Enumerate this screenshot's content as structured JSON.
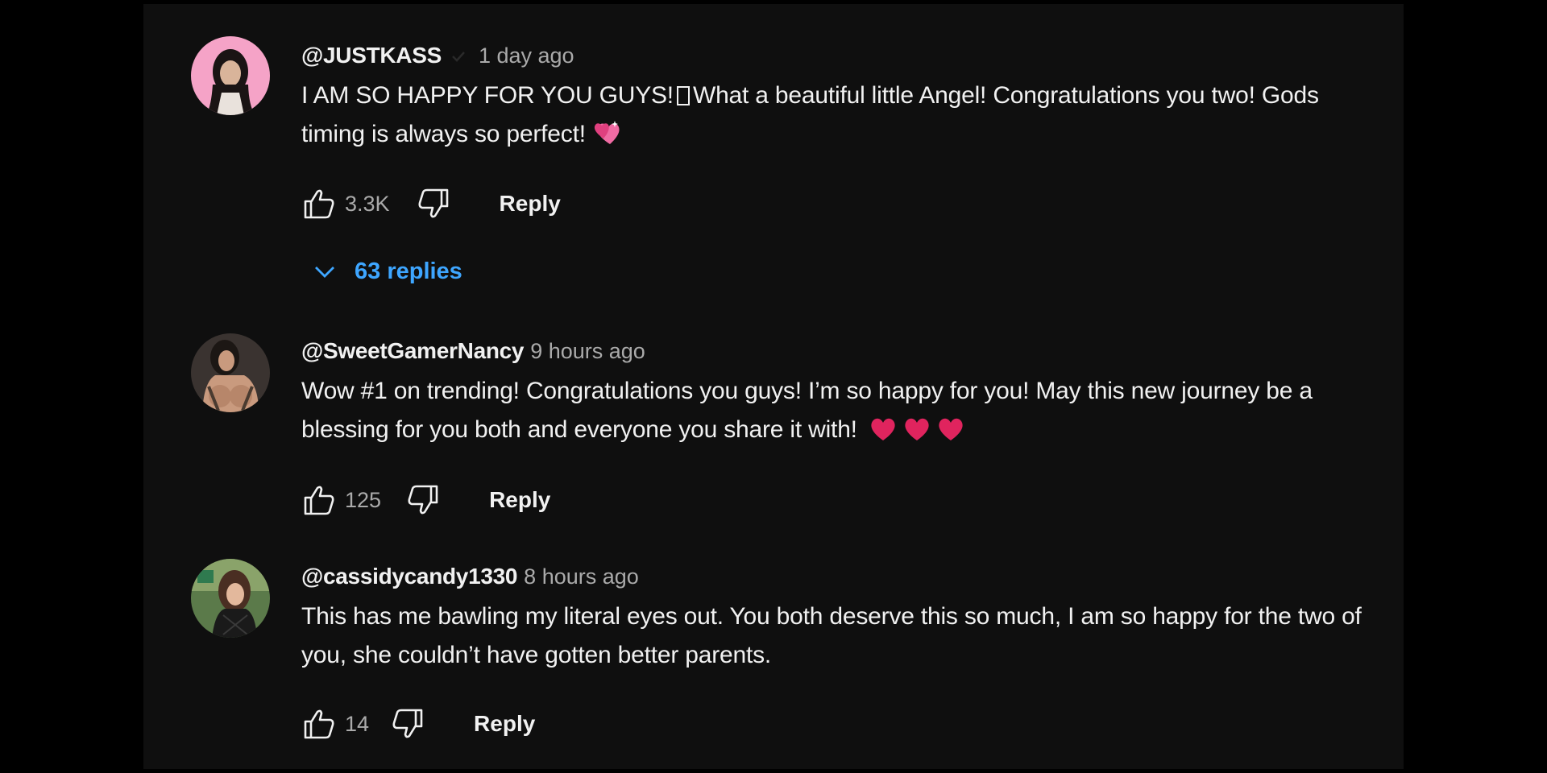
{
  "comments": [
    {
      "author": "@JUSTKASS",
      "verified": true,
      "time": "1 day ago",
      "text": "I AM SO HAPPY FOR YOU GUYS!",
      "text_after_box": "What a beautiful little Angel! Congratulations you two! Gods timing is always so perfect!",
      "emoji": "sparkling-hearts-icon",
      "likes": "3.3K",
      "reply_label": "Reply",
      "replies_label": "63 replies",
      "avatar_bg": "#f5a3c7"
    },
    {
      "author": "@SweetGamerNancy",
      "time": "9 hours ago",
      "text": "Wow #1 on trending! Congratulations you guys! I’m so happy for you! May this new journey be a blessing for you both and everyone you share it with!",
      "emoji": "red-heart-icon",
      "likes": "125",
      "reply_label": "Reply",
      "avatar_bg": "#3a3330"
    },
    {
      "author": "@cassidycandy1330",
      "time": "8 hours ago",
      "text": "This has me bawling my literal eyes out. You both deserve this so much, I am so happy for the two of you, she couldn’t have gotten better parents.",
      "likes": "14",
      "reply_label": "Reply",
      "avatar_bg": "#5b7a4a"
    }
  ],
  "colors": {
    "background": "#0f0f0f",
    "primary_text": "#f1f1f1",
    "secondary_text": "#aaaaaa",
    "link_blue": "#3ea6ff",
    "heart_red": "#e0245e"
  }
}
